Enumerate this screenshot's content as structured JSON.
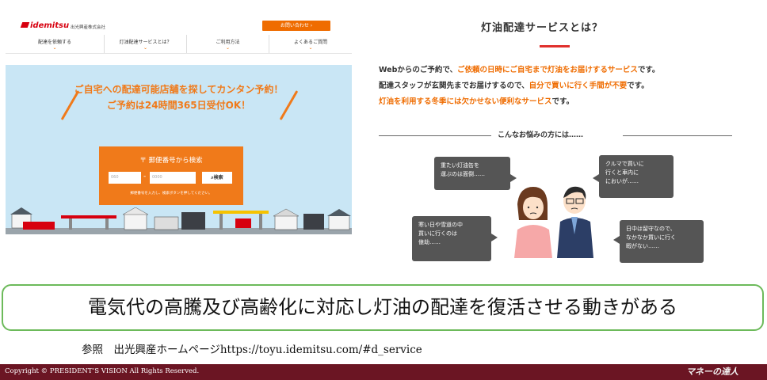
{
  "site": {
    "logo": "idemitsu",
    "company": "出光興産株式会社",
    "contact_button": "お問い合わせ",
    "nav": [
      "配達を依頼する",
      "灯油配達サービスとは？",
      "ご利用方法",
      "よくあるご質問"
    ],
    "hero_line1": "ご自宅への配達可能店舗を探してカンタン予約！",
    "hero_line2": "ご予約は24時間365日受付OK！",
    "search_title": "郵便番号から検索",
    "zip_placeholder1": "060",
    "zip_placeholder2": "0000",
    "search_button": "検索",
    "search_note": "郵便番号を入力し、検索ボタンを押してください。"
  },
  "service": {
    "title": "灯油配達サービスとは？",
    "para1": {
      "a": "Webからのご予約で、",
      "b": "ご依頼の日時にご自宅まで灯油をお届けするサービス",
      "c": "です。"
    },
    "para2": {
      "a": "配達スタッフが玄関先までお届けするので、",
      "b": "自分で買いに行く手間が不要",
      "c": "です。"
    },
    "para3": {
      "a": "灯油を利用する冬季には欠かせない便利なサービス",
      "b": "です。"
    },
    "worry_label": "こんなお悩みの方には……",
    "bubbles": [
      "重たい灯油缶を\n運ぶのは面倒……",
      "寒い日や雪道の中\n買いに行くのは\n億劫……",
      "クルマで買いに\n行くと車内に\nにおいが……",
      "日中は留守なので、\nなかなか買いに行く\n暇がない……"
    ]
  },
  "caption": "電気代の高騰及び高齢化に対応し灯油の配達を復活させる動きがある",
  "reference": "参照　出光興産ホームページhttps://toyu.idemitsu.com/#d_service",
  "footer": {
    "copyright": "Copyright © PRESIDENT’S VISION All Rights Reserved.",
    "brand": "マネーの達人"
  },
  "colors": {
    "accent": "#ef6c00",
    "footer": "#6b1523",
    "caption_border": "#6cba5a",
    "bubble": "#555555"
  }
}
